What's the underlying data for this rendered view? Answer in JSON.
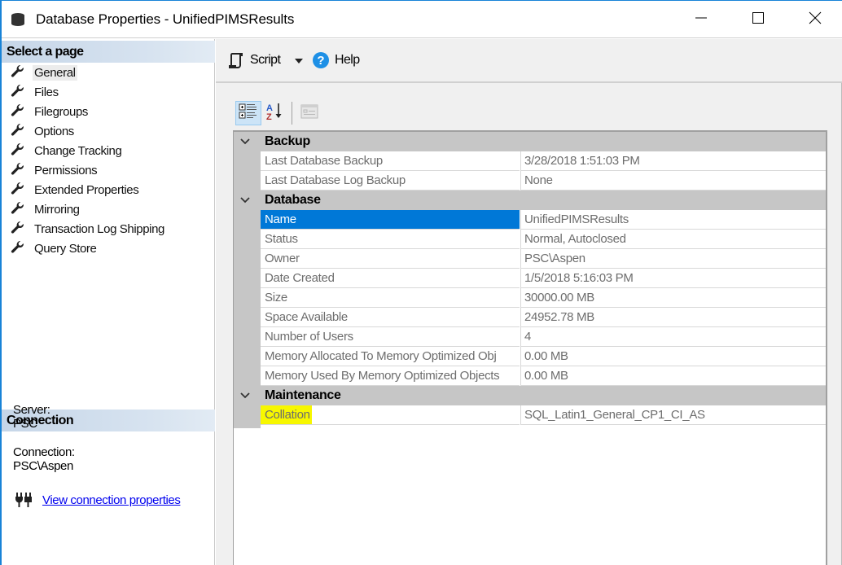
{
  "window": {
    "title": "Database Properties - UnifiedPIMSResults",
    "controls": {
      "minimize": "minimize",
      "maximize": "maximize",
      "close": "close"
    }
  },
  "sidebar": {
    "select_header": "Select a page",
    "pages": [
      {
        "label": "General",
        "icon": "wrench-icon",
        "selected": true
      },
      {
        "label": "Files",
        "icon": "wrench-icon"
      },
      {
        "label": "Filegroups",
        "icon": "wrench-icon"
      },
      {
        "label": "Options",
        "icon": "wrench-icon"
      },
      {
        "label": "Change Tracking",
        "icon": "wrench-icon"
      },
      {
        "label": "Permissions",
        "icon": "wrench-icon"
      },
      {
        "label": "Extended Properties",
        "icon": "wrench-icon"
      },
      {
        "label": "Mirroring",
        "icon": "wrench-icon"
      },
      {
        "label": "Transaction Log Shipping",
        "icon": "wrench-icon"
      },
      {
        "label": "Query Store",
        "icon": "wrench-icon"
      }
    ],
    "connection_header": "Connection",
    "server_label": "Server:",
    "server_value": "PSC",
    "connection_label": "Connection:",
    "connection_value": "PSC\\Aspen",
    "view_link": "View connection properties"
  },
  "toolbar": {
    "script_label": "Script",
    "help_label": "Help"
  },
  "grid_tools": {
    "categorized": "categorized-view",
    "alphabetical": "alphabetical-sort",
    "property_pages": "property-pages"
  },
  "grid": {
    "categories": [
      {
        "name": "Backup",
        "properties": [
          {
            "name": "Last Database Backup",
            "value": "3/28/2018 1:51:03 PM"
          },
          {
            "name": "Last Database Log Backup",
            "value": "None"
          }
        ]
      },
      {
        "name": "Database",
        "properties": [
          {
            "name": "Name",
            "value": "UnifiedPIMSResults",
            "selected": true
          },
          {
            "name": "Status",
            "value": "Normal, Autoclosed"
          },
          {
            "name": "Owner",
            "value": "PSC\\Aspen"
          },
          {
            "name": "Date Created",
            "value": "1/5/2018 5:16:03 PM"
          },
          {
            "name": "Size",
            "value": "30000.00 MB"
          },
          {
            "name": "Space Available",
            "value": "24952.78 MB"
          },
          {
            "name": "Number of Users",
            "value": "4"
          },
          {
            "name": "Memory Allocated To Memory Optimized Obj",
            "value": "0.00 MB"
          },
          {
            "name": "Memory Used By Memory Optimized Objects",
            "value": "0.00 MB"
          }
        ]
      },
      {
        "name": "Maintenance",
        "properties": [
          {
            "name": "Collation",
            "value": "SQL_Latin1_General_CP1_CI_AS",
            "highlighted": true
          }
        ]
      }
    ]
  },
  "colors": {
    "selection": "#0078d7",
    "highlight": "#f7f700",
    "category_bg": "#c6c6c6",
    "link": "#0000ee",
    "window_border": "#1883d7"
  }
}
